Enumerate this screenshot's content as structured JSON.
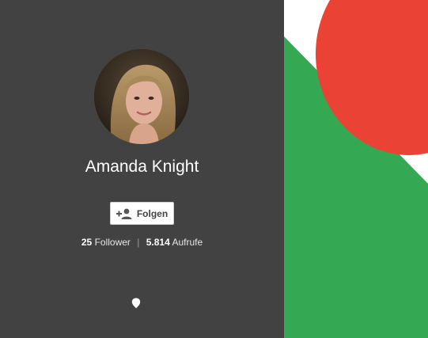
{
  "profile": {
    "name": "Amanda Knight",
    "avatar_alt": "Amanda Knight"
  },
  "follow_button": {
    "label": "Folgen",
    "icon": "person-add-icon"
  },
  "stats": {
    "followers_count": "25",
    "followers_label": "Follower",
    "separator": "|",
    "views_count": "5.814",
    "views_label": "Aufrufe"
  },
  "location": {
    "icon": "map-pin-icon"
  },
  "colors": {
    "panel_background": "#424242",
    "cover_green": "#34a853",
    "cover_red": "#ea4335",
    "cover_white": "#ffffff"
  }
}
